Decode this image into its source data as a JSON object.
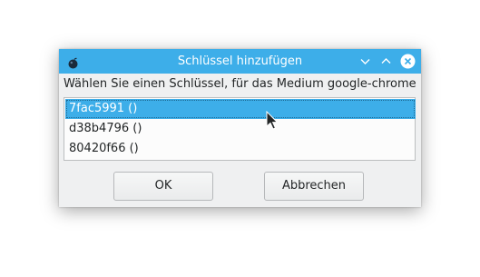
{
  "window": {
    "title": "Schlüssel hinzufügen",
    "app_icon": "bomb-icon",
    "controls": [
      "minimize-icon",
      "maximize-icon",
      "close-icon"
    ]
  },
  "dialog": {
    "prompt": "Wählen Sie einen Schlüssel, für das Medium google-chrome",
    "keys": [
      "7fac5991 ()",
      "d38b4796 ()",
      "80420f66 ()"
    ],
    "selected_index": 0,
    "ok_label": "OK",
    "cancel_label": "Abbrechen"
  },
  "colors": {
    "accent": "#3daee9",
    "window_bg": "#eff0f1",
    "text": "#232627"
  }
}
